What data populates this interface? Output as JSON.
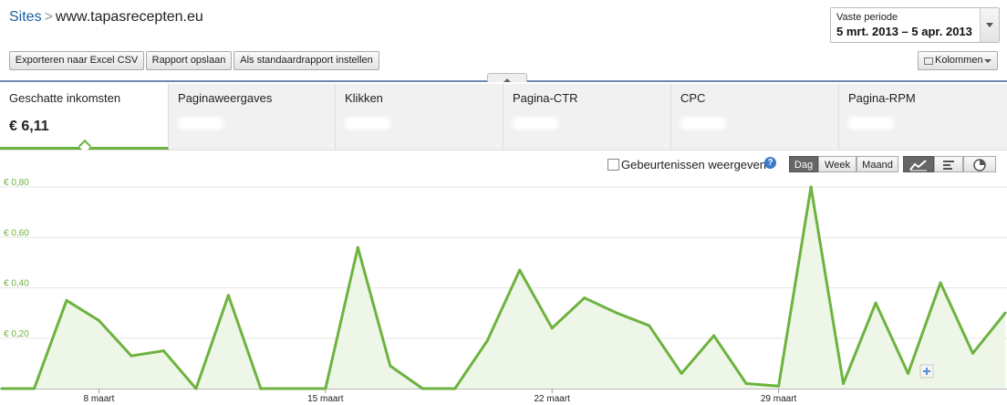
{
  "header": {
    "sites_link": "Sites",
    "separator": ">",
    "site_name": "www.tapasrecepten.eu"
  },
  "period": {
    "label": "Vaste periode",
    "value": "5 mrt. 2013 – 5 apr. 2013"
  },
  "toolbar": {
    "export_label": "Exporteren naar Excel CSV",
    "save_label": "Rapport opslaan",
    "default_label": "Als standaardrapport instellen",
    "columns_label": "Kolommen"
  },
  "tabs": [
    {
      "label": "Geschatte inkomsten",
      "value": "€ 6,11"
    },
    {
      "label": "Paginaweergaves",
      "value": ""
    },
    {
      "label": "Klikken",
      "value": ""
    },
    {
      "label": "Pagina-CTR",
      "value": ""
    },
    {
      "label": "CPC",
      "value": ""
    },
    {
      "label": "Pagina-RPM",
      "value": ""
    }
  ],
  "chart_controls": {
    "events_label": "Gebeurtenissen weergeven",
    "help": "?",
    "granularity": [
      "Dag",
      "Week",
      "Maand"
    ],
    "selected": "Dag"
  },
  "colors": {
    "accent": "#6db33f",
    "fill": "#eef6e8",
    "link": "#1a5e9a"
  },
  "chart_data": {
    "type": "area",
    "ylim": [
      0,
      0.8
    ],
    "y_ticks": [
      "€ 0,20",
      "€ 0,40",
      "€ 0,60",
      "€ 0,80"
    ],
    "y_tick_values": [
      0.2,
      0.4,
      0.6,
      0.8
    ],
    "x_tick_labels": [
      "8 maart",
      "15 maart",
      "22 maart",
      "29 maart"
    ],
    "x_tick_indices": [
      3,
      10,
      17,
      24
    ],
    "x": [
      "5 mrt.",
      "6 mrt.",
      "7 mrt.",
      "8 mrt.",
      "9 mrt.",
      "10 mrt.",
      "11 mrt.",
      "12 mrt.",
      "13 mrt.",
      "14 mrt.",
      "15 mrt.",
      "16 mrt.",
      "17 mrt.",
      "18 mrt.",
      "19 mrt.",
      "20 mrt.",
      "21 mrt.",
      "22 mrt.",
      "23 mrt.",
      "24 mrt.",
      "25 mrt.",
      "26 mrt.",
      "27 mrt.",
      "28 mrt.",
      "29 mrt.",
      "30 mrt.",
      "31 mrt.",
      "1 apr.",
      "2 apr.",
      "3 apr.",
      "4 apr.",
      "5 apr."
    ],
    "values": [
      0,
      0,
      0.35,
      0.27,
      0.13,
      0.15,
      0,
      0.37,
      0,
      0,
      0,
      0.56,
      0.09,
      0,
      0,
      0.19,
      0.47,
      0.24,
      0.36,
      0.3,
      0.25,
      0.06,
      0.21,
      0.02,
      0.01,
      0.8,
      0.02,
      0.34,
      0.06,
      0.42,
      0.14,
      0.3
    ]
  }
}
